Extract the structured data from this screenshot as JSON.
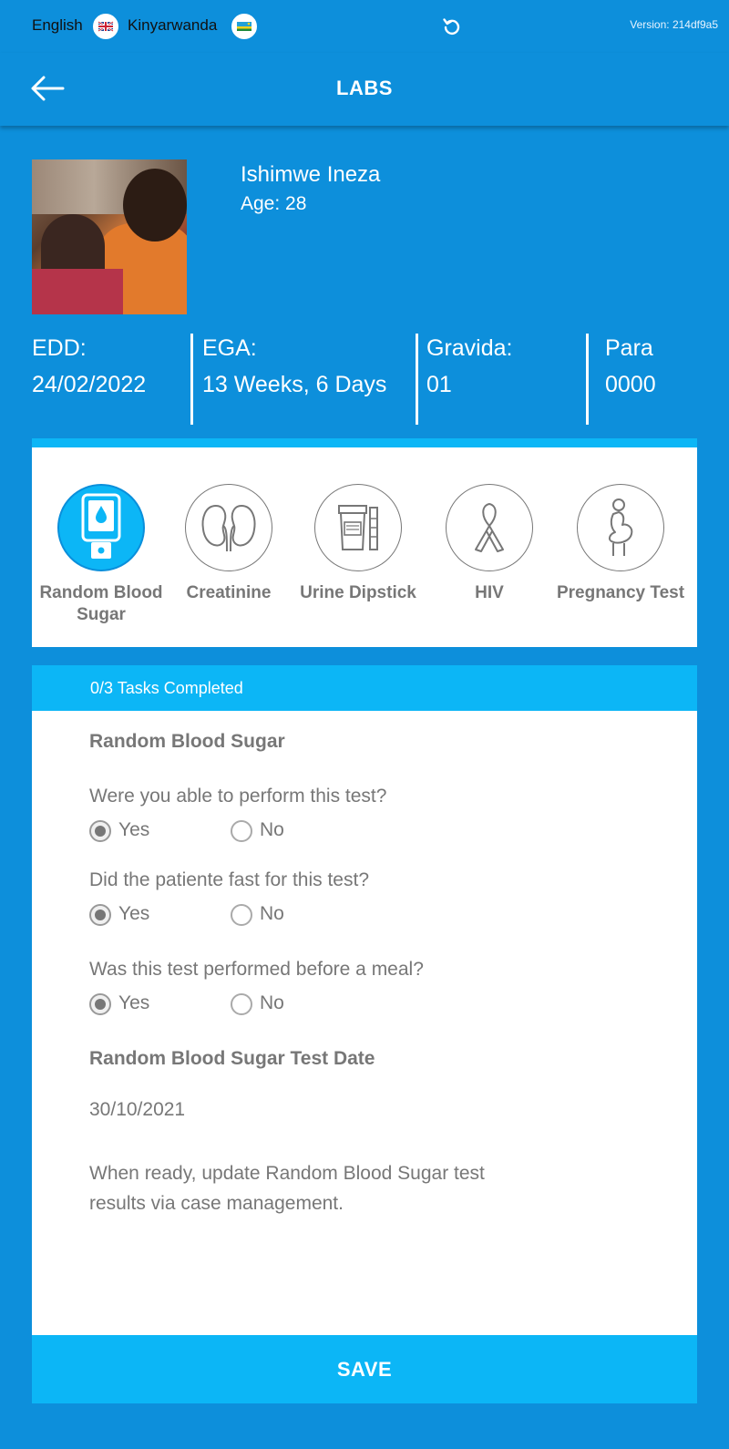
{
  "topbar": {
    "lang_en": "English",
    "lang_rw": "Kinyarwanda",
    "version": "Version: 214df9a5"
  },
  "appbar": {
    "title": "LABS"
  },
  "patient": {
    "name": "Ishimwe Ineza",
    "age": "Age: 28",
    "stats": [
      {
        "label": "EDD:",
        "value": "24/02/2022"
      },
      {
        "label": "EGA:",
        "value": "13 Weeks, 6 Days"
      },
      {
        "label": "Gravida:",
        "value": "01"
      },
      {
        "label": "Para",
        "value": "0000"
      }
    ]
  },
  "tabs": [
    {
      "label": "Random Blood Sugar",
      "icon": "glucometer-icon",
      "active": true
    },
    {
      "label": "Creatinine",
      "icon": "kidney-icon",
      "active": false
    },
    {
      "label": "Urine Dipstick",
      "icon": "urine-container-icon",
      "active": false
    },
    {
      "label": "HIV",
      "icon": "awareness-ribbon-icon",
      "active": false
    },
    {
      "label": "Pregnancy Test",
      "icon": "pregnant-woman-icon",
      "active": false
    }
  ],
  "form": {
    "progress": "0/3 Tasks Completed",
    "section_title": "Random Blood Sugar",
    "questions": [
      {
        "text": "Were you able to perform this test?",
        "yes": "Yes",
        "no": "No",
        "selected": "Yes"
      },
      {
        "text": "Did the patiente fast for this test?",
        "yes": "Yes",
        "no": "No",
        "selected": "Yes"
      },
      {
        "text": "Was this test performed before a meal?",
        "yes": "Yes",
        "no": "No",
        "selected": "Yes"
      }
    ],
    "date_title": "Random Blood Sugar Test Date",
    "date_value": "30/10/2021",
    "note_line1": "When ready, update Random Blood Sugar test",
    "note_line2": "results via case management."
  },
  "save_label": "SAVE",
  "colors": {
    "background": "#0d8fdb",
    "accent": "#0cb6f6",
    "text_gray": "#777777"
  }
}
